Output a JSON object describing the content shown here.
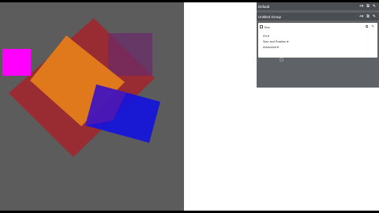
{
  "panel": {
    "default_label": "Default",
    "group_label": "Untitled Group",
    "layer": {
      "name": "Box",
      "sections": [
        "Fill ▾",
        "Size and Position ▾",
        "Advanced ▾"
      ]
    },
    "icons": [
      "add-icon",
      "duplicate-icon",
      "edit-icon"
    ]
  },
  "canvas": {
    "background": "#5c5c5c",
    "shapes": [
      {
        "name": "dark-red-square",
        "color": "#a3232b"
      },
      {
        "name": "purple-square",
        "color": "#6a2a5e"
      },
      {
        "name": "orange-square",
        "color": "#e07a1a"
      },
      {
        "name": "magenta-square",
        "color": "#ff00ff"
      },
      {
        "name": "blue-square",
        "color": "#1010e0"
      }
    ]
  }
}
